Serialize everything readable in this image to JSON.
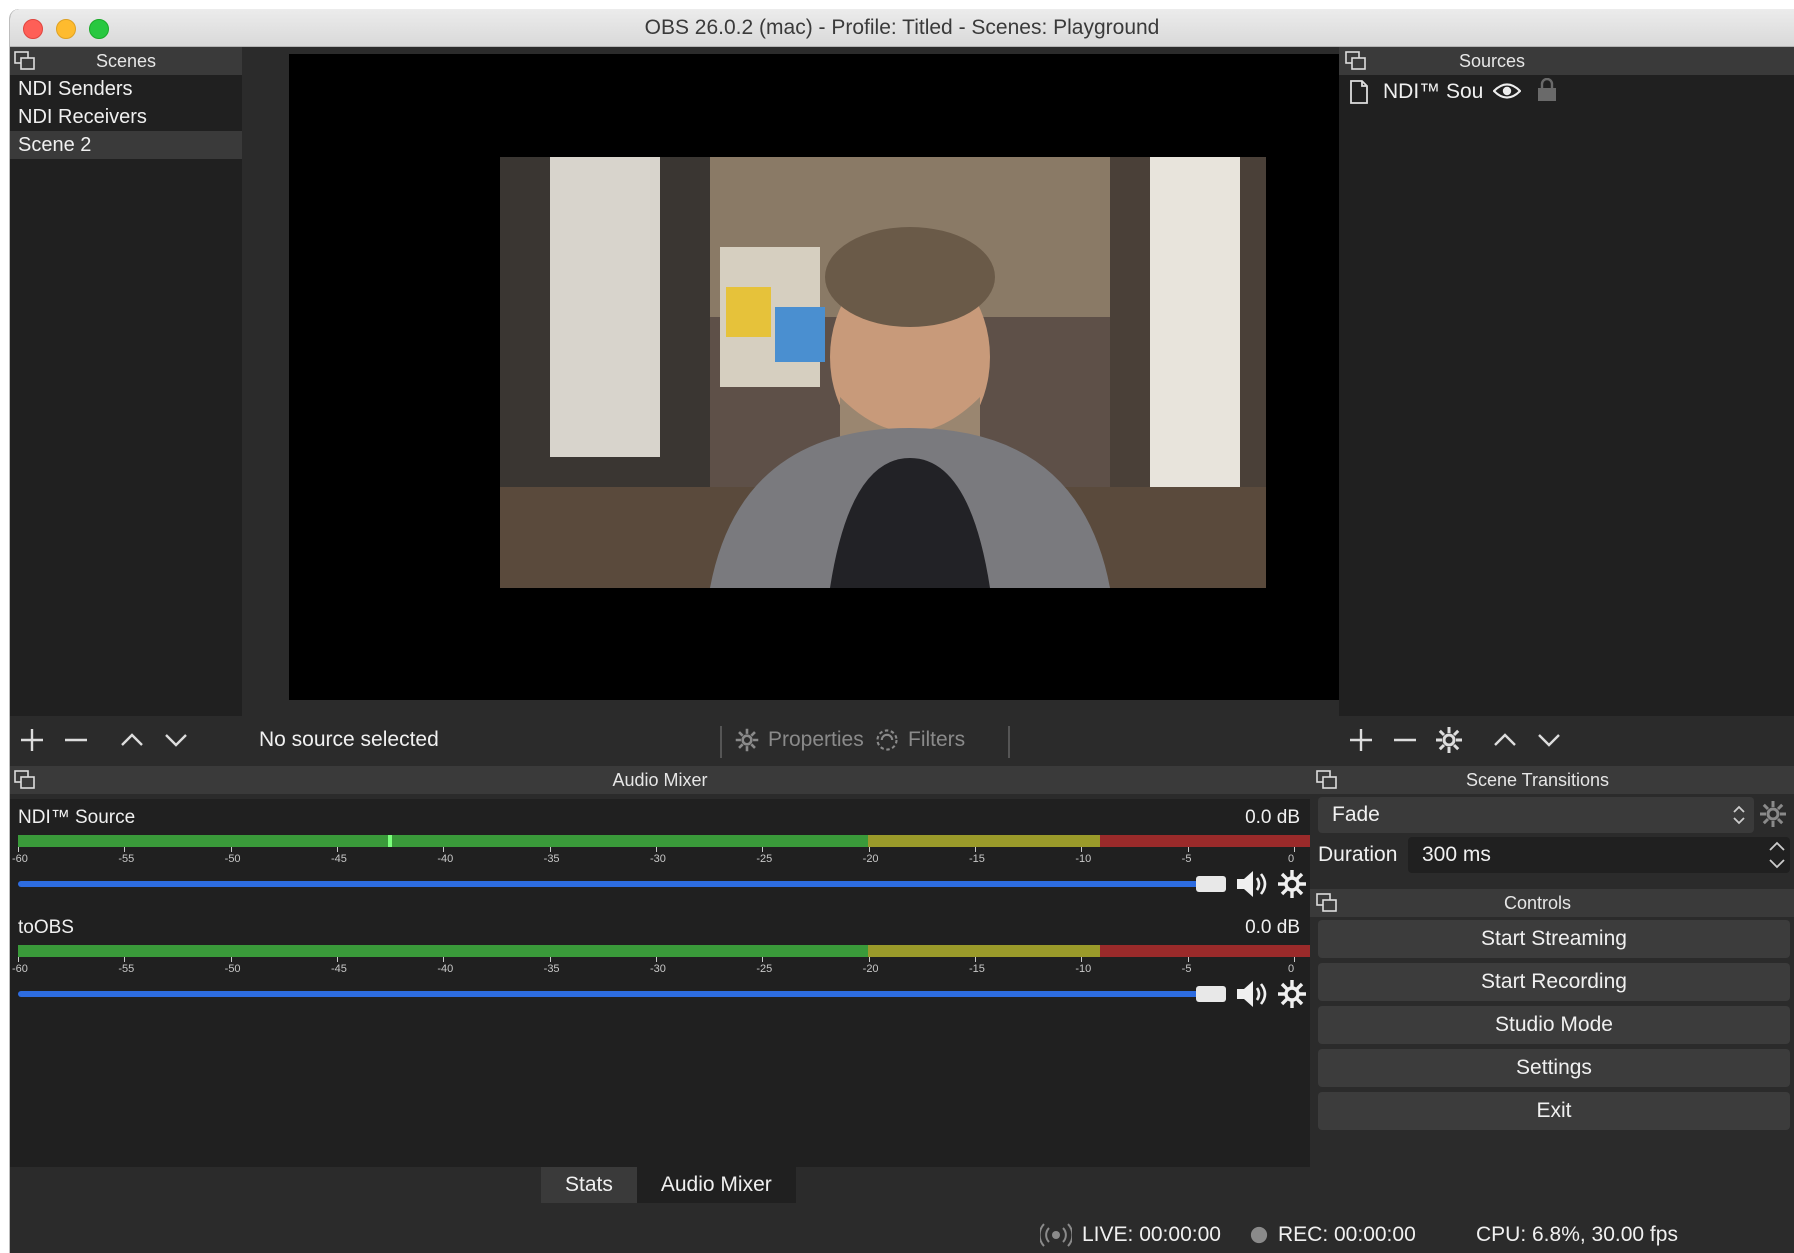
{
  "window": {
    "title": "OBS 26.0.2 (mac) - Profile: Titled - Scenes: Playground"
  },
  "scenes": {
    "title": "Scenes",
    "items": [
      {
        "label": "NDI Senders"
      },
      {
        "label": "NDI Receivers"
      },
      {
        "label": "Scene 2"
      }
    ],
    "selected": "Scene 2"
  },
  "sources": {
    "title": "Sources",
    "items": [
      {
        "label": "NDI™ Sou",
        "icon": "file-icon",
        "visible": true,
        "locked": true
      }
    ]
  },
  "preview": {
    "no_source": "No source selected",
    "properties_label": "Properties",
    "filters_label": "Filters"
  },
  "audio_mixer": {
    "title": "Audio Mixer",
    "ticks": [
      "-60",
      "-55",
      "-50",
      "-45",
      "-40",
      "-35",
      "-30",
      "-25",
      "-20",
      "-15",
      "-10",
      "-5",
      "0"
    ],
    "channels": [
      {
        "name": "NDI™ Source",
        "db": "0.0 dB",
        "volume": 1.0
      },
      {
        "name": "toOBS",
        "db": "0.0 dB",
        "volume": 1.0
      }
    ]
  },
  "scene_transitions": {
    "title": "Scene Transitions",
    "transition": "Fade",
    "duration_label": "Duration",
    "duration_value": "300 ms"
  },
  "controls": {
    "title": "Controls",
    "buttons": [
      {
        "label": "Start Streaming"
      },
      {
        "label": "Start Recording"
      },
      {
        "label": "Studio Mode"
      },
      {
        "label": "Settings"
      },
      {
        "label": "Exit"
      }
    ]
  },
  "tabs": [
    {
      "label": "Stats"
    },
    {
      "label": "Audio Mixer"
    }
  ],
  "status": {
    "live": "LIVE: 00:00:00",
    "rec": "REC: 00:00:00",
    "cpu": "CPU: 6.8%, 30.00 fps"
  },
  "colors": {
    "accent": "#2d6ce0",
    "meter_green": "#3a9a3a",
    "meter_yellow": "#9a9a2a",
    "meter_red": "#9a2a2a"
  }
}
